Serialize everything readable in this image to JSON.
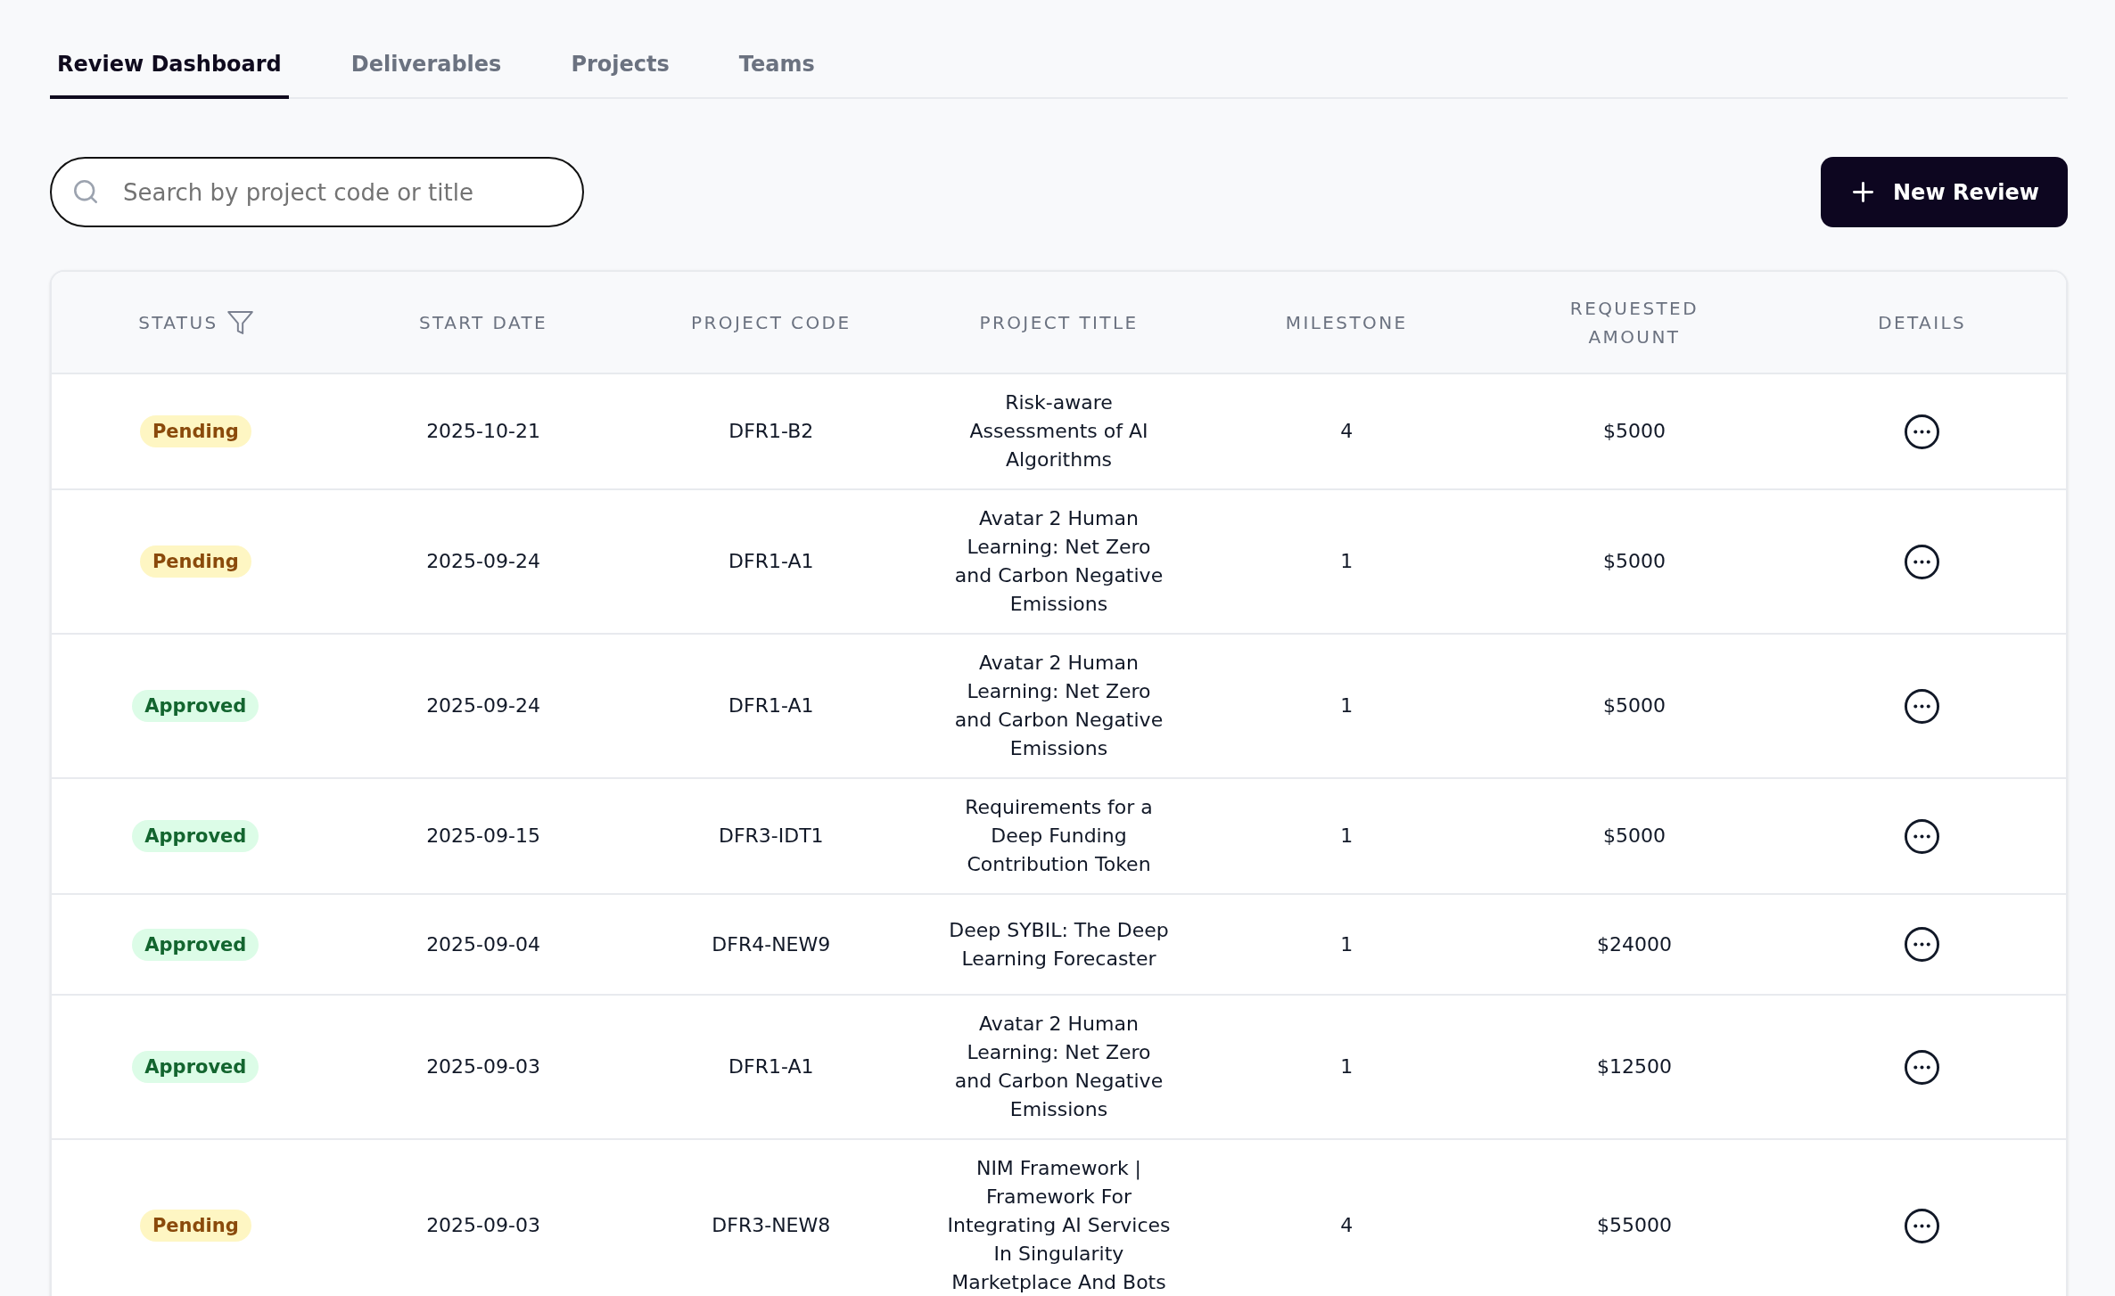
{
  "tabs": [
    {
      "label": "Review Dashboard",
      "selected": true
    },
    {
      "label": "Deliverables",
      "selected": false
    },
    {
      "label": "Projects",
      "selected": false
    },
    {
      "label": "Teams",
      "selected": false
    }
  ],
  "search": {
    "placeholder": "Search by project code or title"
  },
  "new_review_button": {
    "label": "New Review"
  },
  "table": {
    "columns": [
      {
        "label": "STATUS",
        "filterable": true
      },
      {
        "label": "START DATE",
        "filterable": false
      },
      {
        "label": "PROJECT CODE",
        "filterable": false
      },
      {
        "label": "PROJECT TITLE",
        "filterable": false
      },
      {
        "label": "MILESTONE",
        "filterable": false
      },
      {
        "label": "REQUESTED AMOUNT",
        "filterable": false
      },
      {
        "label": "DETAILS",
        "filterable": false
      }
    ],
    "rows": [
      {
        "status": "Pending",
        "kind": "pending",
        "start_date": "2025-10-21",
        "project_code": "DFR1-B2",
        "project_title": "Risk-aware Assessments of AI Algorithms",
        "milestone": "4",
        "requested_amount": "$5000"
      },
      {
        "status": "Pending",
        "kind": "pending",
        "start_date": "2025-09-24",
        "project_code": "DFR1-A1",
        "project_title": "Avatar 2 Human Learning: Net Zero and Carbon Negative Emissions",
        "milestone": "1",
        "requested_amount": "$5000"
      },
      {
        "status": "Approved",
        "kind": "approved",
        "start_date": "2025-09-24",
        "project_code": "DFR1-A1",
        "project_title": "Avatar 2 Human Learning: Net Zero and Carbon Negative Emissions",
        "milestone": "1",
        "requested_amount": "$5000"
      },
      {
        "status": "Approved",
        "kind": "approved",
        "start_date": "2025-09-15",
        "project_code": "DFR3-IDT1",
        "project_title": "Requirements for a Deep Funding Contribution Token",
        "milestone": "1",
        "requested_amount": "$5000"
      },
      {
        "status": "Approved",
        "kind": "approved",
        "start_date": "2025-09-04",
        "project_code": "DFR4-NEW9",
        "project_title": "Deep SYBIL: The Deep Learning Forecaster",
        "milestone": "1",
        "requested_amount": "$24000"
      },
      {
        "status": "Approved",
        "kind": "approved",
        "start_date": "2025-09-03",
        "project_code": "DFR1-A1",
        "project_title": "Avatar 2 Human Learning: Net Zero and Carbon Negative Emissions",
        "milestone": "1",
        "requested_amount": "$12500"
      },
      {
        "status": "Pending",
        "kind": "pending",
        "start_date": "2025-09-03",
        "project_code": "DFR3-NEW8",
        "project_title": "NIM Framework | Framework For Integrating AI Services In Singularity Marketplace And Bots",
        "milestone": "4",
        "requested_amount": "$55000"
      }
    ]
  }
}
